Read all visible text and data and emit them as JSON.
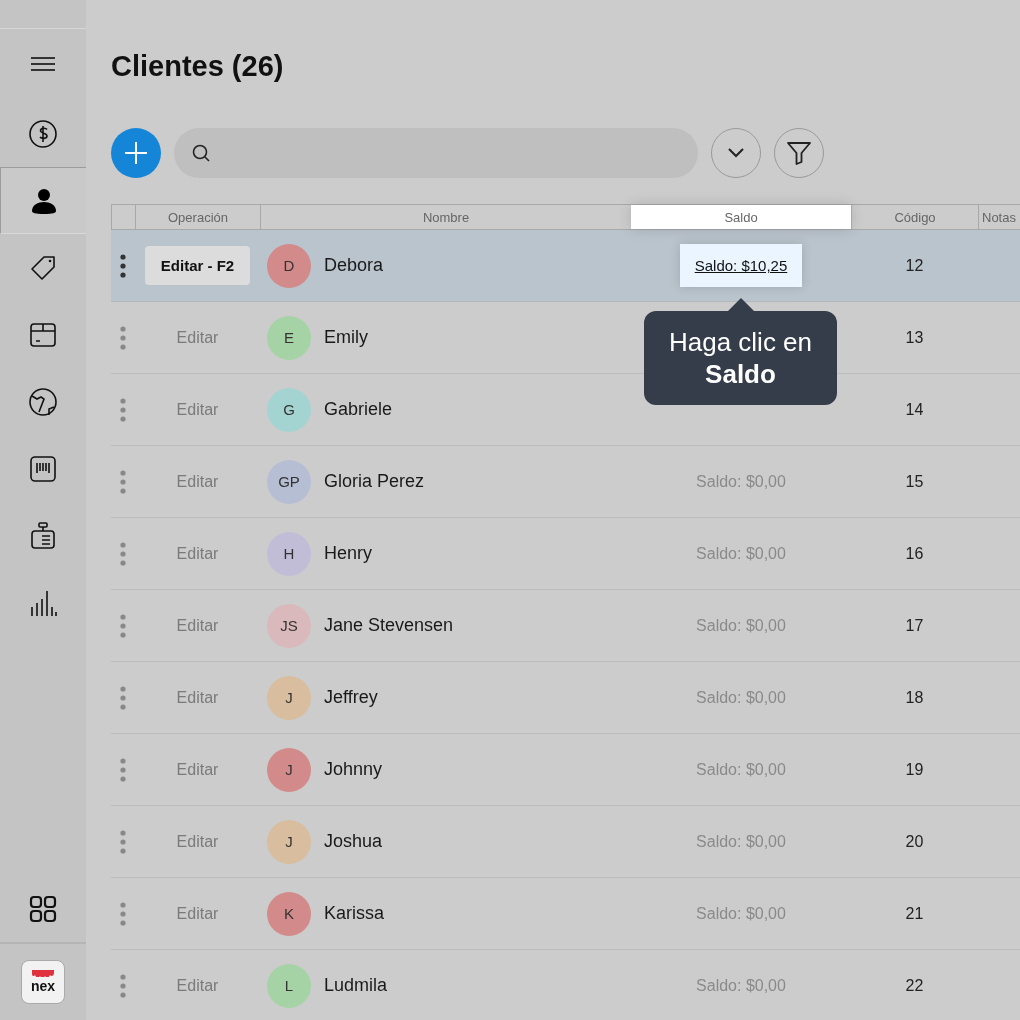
{
  "sidebar": {
    "items": [
      {
        "selected": false
      },
      {
        "selected": false
      },
      {
        "selected": true
      },
      {
        "selected": false
      },
      {
        "selected": false
      },
      {
        "selected": false
      },
      {
        "selected": false
      },
      {
        "selected": false
      },
      {
        "selected": false
      }
    ],
    "logo": "nex"
  },
  "title": "Clientes (26)",
  "table": {
    "columns": [
      {
        "label": "Operación",
        "highlighted": false
      },
      {
        "label": "Nombre",
        "highlighted": false
      },
      {
        "label": "Saldo",
        "highlighted": true
      },
      {
        "label": "Código",
        "highlighted": false
      },
      {
        "label": "Notas",
        "highlighted": false
      }
    ],
    "rows": [
      {
        "action": "Editar - F2",
        "initials": "D",
        "color": "#d38a8a",
        "name": "Debora",
        "saldo": "Saldo: $10,25",
        "code": "12",
        "selected": true
      },
      {
        "action": "Editar",
        "initials": "E",
        "color": "#a6d3a6",
        "name": "Emily",
        "code": "13",
        "selected": false
      },
      {
        "action": "Editar",
        "initials": "G",
        "color": "#a3d4d1",
        "name": "Gabriele",
        "code": "14",
        "selected": false
      },
      {
        "action": "Editar",
        "initials": "GP",
        "color": "#b6bed3",
        "name": "Gloria Perez",
        "saldo": "Saldo: $0,00",
        "code": "15",
        "selected": false
      },
      {
        "action": "Editar",
        "initials": "H",
        "color": "#c2bdd7",
        "name": "Henry",
        "saldo": "Saldo: $0,00",
        "code": "16",
        "selected": false
      },
      {
        "action": "Editar",
        "initials": "JS",
        "color": "#d9b9bb",
        "name": "Jane Stevensen",
        "saldo": "Saldo: $0,00",
        "code": "17",
        "selected": false
      },
      {
        "action": "Editar",
        "initials": "J",
        "color": "#d8bd9f",
        "name": "Jeffrey",
        "saldo": "Saldo: $0,00",
        "code": "18",
        "selected": false
      },
      {
        "action": "Editar",
        "initials": "J",
        "color": "#d38a8a",
        "name": "Johnny",
        "saldo": "Saldo: $0,00",
        "code": "19",
        "selected": false
      },
      {
        "action": "Editar",
        "initials": "J",
        "color": "#d8bd9f",
        "name": "Joshua",
        "saldo": "Saldo: $0,00",
        "code": "20",
        "selected": false
      },
      {
        "action": "Editar",
        "initials": "K",
        "color": "#d38a8a",
        "name": "Karissa",
        "saldo": "Saldo: $0,00",
        "code": "21",
        "selected": false
      },
      {
        "action": "Editar",
        "initials": "L",
        "color": "#a6d3a6",
        "name": "Ludmila",
        "saldo": "Saldo: $0,00",
        "code": "22",
        "selected": false
      }
    ]
  },
  "tooltip": "Haga clic en **Saldo**"
}
